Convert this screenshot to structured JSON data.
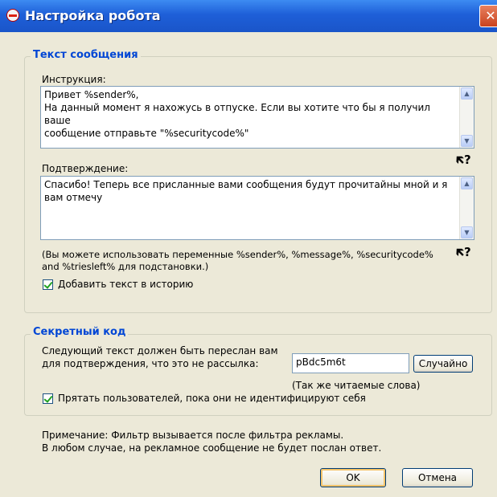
{
  "window": {
    "title": "Настройка робота",
    "close_glyph": "✕"
  },
  "message_group": {
    "legend": "Текст сообщения",
    "instruction_label": "Инструкция:",
    "instruction_text": "Привет %sender%,\nНа данный момент я нахожусь в отпуске. Если вы хотите что бы я получил ваше\nсообщение отправьте \"%securitycode%\"",
    "confirmation_label": "Подтверждение:",
    "confirmation_text": "Спасибо! Теперь все присланные вами сообщения будут прочитайны мной и я\nвам отмечу",
    "variables_hint_line1": "(Вы можете использовать переменные %sender%, %message%, %securitycode%",
    "variables_hint_line2": "and %triesleft% для подстановки.)",
    "add_history_label": "Добавить текст в историю",
    "add_history_checked": true,
    "help_glyph": "?"
  },
  "secret_group": {
    "legend": "Секретный код",
    "desc_line1": "Следующий текст должен быть переслан вам",
    "desc_line2": "для подтверждения, что это не рассылка:",
    "code_value": "pBdc5m6t",
    "random_button": "Случайно",
    "readable_hint": "(Так же читаемые слова)",
    "hide_users_label": "Прятать пользователей, пока они не идентифицируют себя",
    "hide_users_checked": true
  },
  "note": {
    "line1": "Примечание: Фильтр вызывается после фильтра рекламы.",
    "line2": "В любом случае, на рекламное сообщение не будет послан ответ."
  },
  "buttons": {
    "ok": "OK",
    "cancel": "Отмена"
  }
}
